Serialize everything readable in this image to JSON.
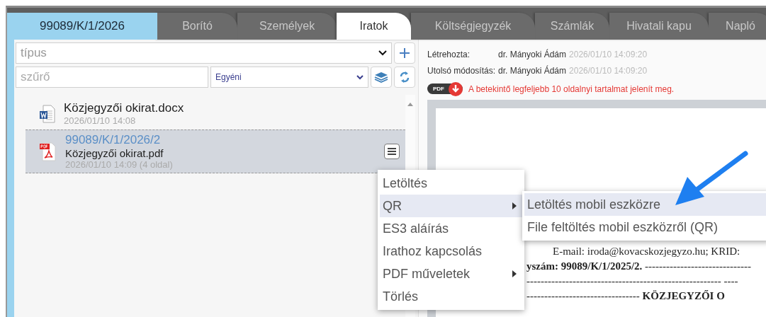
{
  "tabs": [
    {
      "label": "99089/K/1/2026",
      "kind": "case",
      "selected": false
    },
    {
      "label": "Borító",
      "kind": "page",
      "selected": false
    },
    {
      "label": "Személyek",
      "kind": "page",
      "selected": false
    },
    {
      "label": "Iratok",
      "kind": "page",
      "selected": true
    },
    {
      "label": "Költségjegyzék",
      "kind": "page",
      "selected": false
    },
    {
      "label": "Számlák",
      "kind": "page",
      "selected": false
    },
    {
      "label": "Hivatali kapu",
      "kind": "page",
      "selected": false
    },
    {
      "label": "Napló",
      "kind": "page",
      "selected": false
    }
  ],
  "type_select": {
    "placeholder": "típus"
  },
  "filter": {
    "placeholder": "szűrő"
  },
  "view_select": {
    "value": "Egyéni"
  },
  "documents": [
    {
      "kind": "docx",
      "name": "Közjegyzői okirat.docx",
      "meta": "2026/01/10 14:08",
      "selected": false
    },
    {
      "kind": "pdf",
      "number": "99089/K/1/2026/2",
      "name": "Közjegyzői okirat.pdf",
      "meta": "2026/01/10 14:09 (4 oldal)",
      "selected": true
    }
  ],
  "info": [
    {
      "label": "Létrehozta:",
      "user": "dr. Mányoki Ádám",
      "time": "2026/01/10 14:09:20"
    },
    {
      "label": "Utolsó módosítás:",
      "user": "dr. Mányoki Ádám",
      "time": "2026/01/10 14:09:20"
    }
  ],
  "pdf_notice": {
    "badge": "PDF",
    "text": "A betekintő legfeljebb 10 oldalnyi tartalmat jelenít meg."
  },
  "preview_lines": [
    "E-mail: iroda@kovacskozjegyzo.hu; KRID:",
    "**yszám: 99089/K/1/2025/2.** ------------------------------",
    "-------------------------------------------------------   ----",
    "-------------------------------- **KÖZJEGYZŐI O**"
  ],
  "context_menu": [
    {
      "label": "Letöltés",
      "selected": false,
      "submenu": false
    },
    {
      "label": "QR",
      "selected": true,
      "submenu": true
    },
    {
      "label": "ES3 aláírás",
      "selected": false,
      "submenu": false
    },
    {
      "label": "Irathoz kapcsolás",
      "selected": false,
      "submenu": false
    },
    {
      "label": "PDF műveletek",
      "selected": false,
      "submenu": true
    },
    {
      "label": "Törlés",
      "selected": false,
      "submenu": false
    }
  ],
  "submenu": [
    {
      "label": "Letöltés mobil eszközre",
      "selected": true
    },
    {
      "label": "File feltöltés mobil eszközről (QR)",
      "selected": false
    }
  ]
}
